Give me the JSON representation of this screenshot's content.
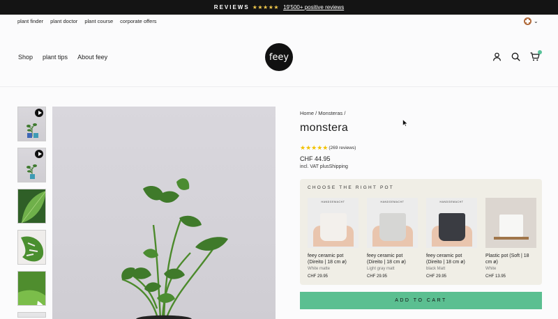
{
  "topbar": {
    "reviews_label": "REVIEWS",
    "stars": "★★★★★",
    "positive_reviews": "19'500+ positive reviews"
  },
  "sublinks": [
    "plant finder",
    "plant doctor",
    "plant course",
    "corporate offers"
  ],
  "mainnav": [
    "Shop",
    "plant tips",
    "About feey"
  ],
  "logo": "feey",
  "icons": {
    "account": "user-icon",
    "search": "search-icon",
    "cart": "cart-icon",
    "language": "swiss-flag-icon",
    "chevron": "chevron-down-icon"
  },
  "colors": {
    "accent": "#5bbf91",
    "topbar": "#141414",
    "stars": "#f2c200"
  },
  "product": {
    "breadcrumb": "Home / Monsteras /",
    "title": "monstera",
    "stars": "★★★★★",
    "reviews": "(269 reviews)",
    "rating": 5,
    "price": "CHF 44.95",
    "vat": "incl. VAT plusShipping"
  },
  "pots": {
    "header": "CHOOSE THE RIGHT POT",
    "items": [
      {
        "brand": "HANDGEMACHT",
        "name": "feey ceramic pot (Direito | 18 cm ø)",
        "sub": "White matte",
        "price": "CHF 29.95",
        "color": "#f3f0ec"
      },
      {
        "brand": "HANDGEMACHT",
        "name": "feey ceramic pot (Direito | 18 cm ø)",
        "sub": "Light gray matt",
        "price": "CHF 29.95",
        "color": "#d6d6d4"
      },
      {
        "brand": "HANDGEMACHT",
        "name": "feey ceramic pot (Direito | 18 cm ø)",
        "sub": "black Matt",
        "price": "CHF 29.95",
        "color": "#3a3c42"
      },
      {
        "brand": "",
        "name": "Plastic pot (Soft | 18 cm ø)",
        "sub": "White",
        "price": "CHF 13.95",
        "color": "#f7f7f5"
      }
    ]
  },
  "add_to_cart": "ADD TO CART"
}
